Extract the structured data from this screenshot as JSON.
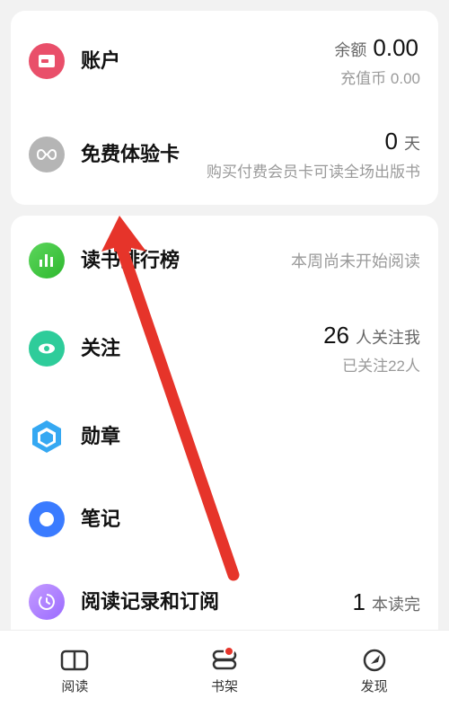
{
  "card1": {
    "account": {
      "label": "账户",
      "balance_label": "余额",
      "balance_value": "0.00",
      "coin_label": "充值币",
      "coin_value": "0.00"
    },
    "trial": {
      "label": "免费体验卡",
      "days_value": "0",
      "days_unit": "天",
      "desc": "购买付费会员卡可读全场出版书"
    }
  },
  "card2": {
    "ranking": {
      "label": "读书排行榜",
      "status": "本周尚未开始阅读"
    },
    "follow": {
      "label": "关注",
      "followers_value": "26",
      "followers_unit": "人关注我",
      "following": "已关注22人"
    },
    "badge": {
      "label": "勋章"
    },
    "notes": {
      "label": "笔记"
    },
    "history": {
      "label": "阅读记录和订阅",
      "finished_value": "1",
      "finished_unit": "本读完"
    }
  },
  "nav": {
    "read": "阅读",
    "shelf": "书架",
    "discover": "发现"
  }
}
